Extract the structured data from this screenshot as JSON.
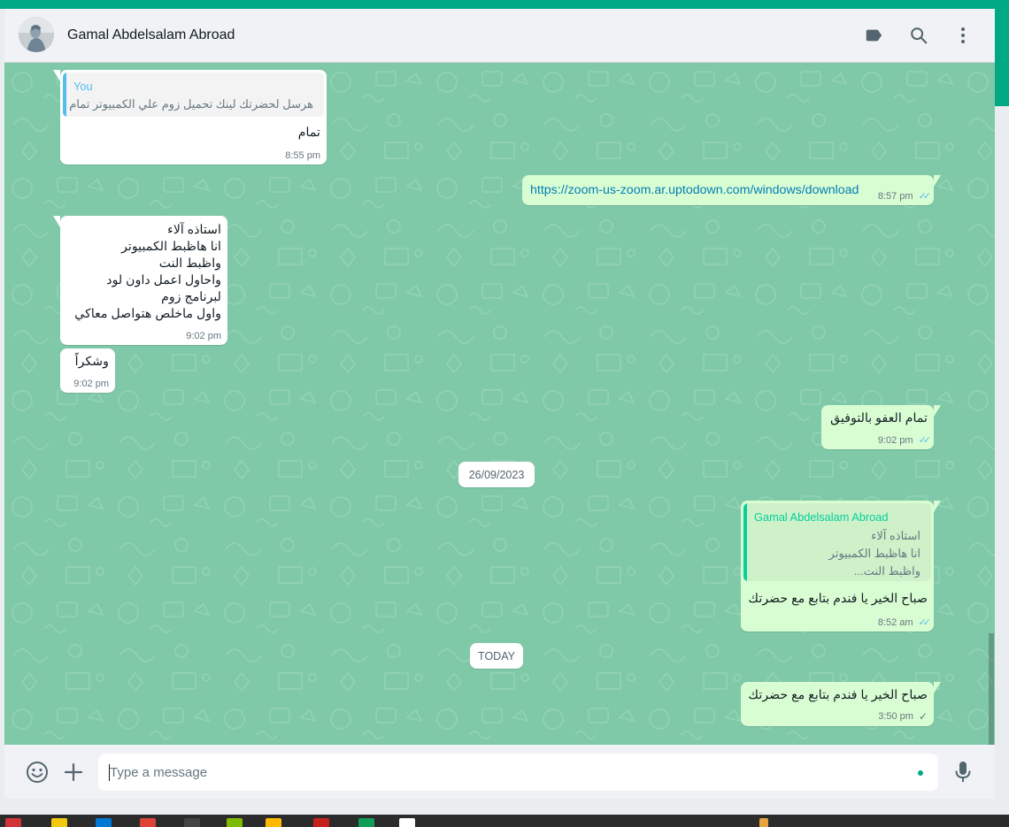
{
  "header": {
    "contact_name": "Gamal Abdelsalam Abroad",
    "icons": [
      "label-icon",
      "search-icon",
      "menu-icon"
    ]
  },
  "messages": [
    {
      "direction": "incoming",
      "quote_author": "You",
      "quote_text": "هرسل لحضرتك لينك تحميل زوم علي الكمبيوتر تمام",
      "text": "تمام",
      "time": "8:55 pm"
    },
    {
      "direction": "outgoing",
      "text": "https://zoom-us-zoom.ar.uptodown.com/windows/download",
      "time": "8:57 pm",
      "status": "read"
    },
    {
      "direction": "incoming",
      "text": "استاذه آلاء\nانا هاظبط الكمبيوتر\nواظبط النت\nواحاول اعمل داون لود\nلبرنامج زوم\nواول ماخلص هتواصل معاكي",
      "time": "9:02 pm"
    },
    {
      "direction": "incoming",
      "text": "وشكراً",
      "time": "9:02 pm"
    },
    {
      "direction": "outgoing",
      "text": "تمام العفو بالتوفيق",
      "time": "9:02 pm",
      "status": "read"
    },
    {
      "direction": "outgoing",
      "quote_author": "Gamal Abdelsalam Abroad",
      "quote_text": "استاذه آلاء\nانا هاظبط الكمبيوتر\nواظبط النت...",
      "text": "صباح الخير يا فندم بتابع مع حضرتك",
      "time": "8:52 am",
      "status": "read"
    },
    {
      "direction": "outgoing",
      "text": "صباح الخير يا فندم بتابع مع حضرتك",
      "time": "3:50 pm",
      "status": "sent"
    }
  ],
  "date_chips": [
    "26/09/2023",
    "TODAY"
  ],
  "composer": {
    "placeholder": "Type a message",
    "icons": [
      "emoji-icon",
      "plus-icon",
      "mic-icon"
    ]
  },
  "colors": {
    "accent": "#00a884",
    "outgoing_bubble": "#d9fdd3",
    "incoming_bubble": "#ffffff",
    "chat_background": "#80c9a8",
    "read_ticks": "#53bdeb",
    "you_quote": "#53bdeb",
    "contact_quote": "#06cf9c"
  }
}
